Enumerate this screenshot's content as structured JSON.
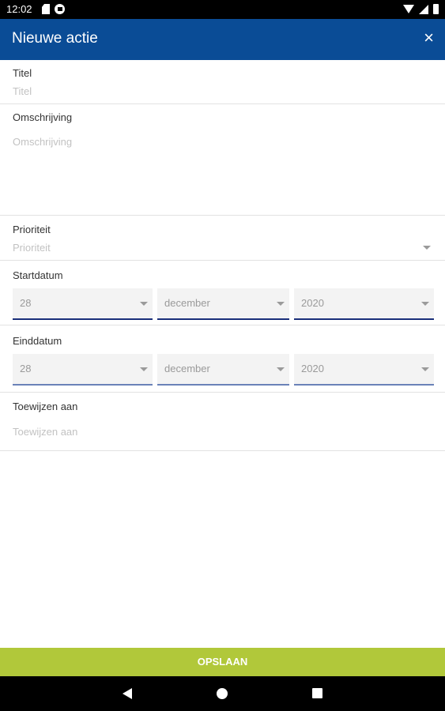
{
  "status_bar": {
    "time": "12:02"
  },
  "app_bar": {
    "title": "Nieuwe actie",
    "close_label": "×"
  },
  "form": {
    "titel": {
      "label": "Titel",
      "placeholder": "Titel"
    },
    "omschrijving": {
      "label": "Omschrijving",
      "placeholder": "Omschrijving"
    },
    "prioriteit": {
      "label": "Prioriteit",
      "placeholder": "Prioriteit"
    },
    "startdatum": {
      "label": "Startdatum",
      "day": "28",
      "month": "december",
      "year": "2020"
    },
    "einddatum": {
      "label": "Einddatum",
      "day": "28",
      "month": "december",
      "year": "2020"
    },
    "toewijzen": {
      "label": "Toewijzen aan",
      "placeholder": "Toewijzen aan"
    }
  },
  "save_button": {
    "label": "OPSLAAN"
  },
  "icons": {
    "status_left": [
      "sd-card-icon",
      "app-notification-icon"
    ],
    "status_right": [
      "wifi-icon",
      "signal-icon",
      "battery-icon"
    ],
    "nav": [
      "back-icon",
      "home-icon",
      "recents-icon"
    ]
  },
  "colors": {
    "app_bar": "#0a4c96",
    "save_bar": "#b1c83a",
    "date_underline": "#1a2f7a"
  }
}
